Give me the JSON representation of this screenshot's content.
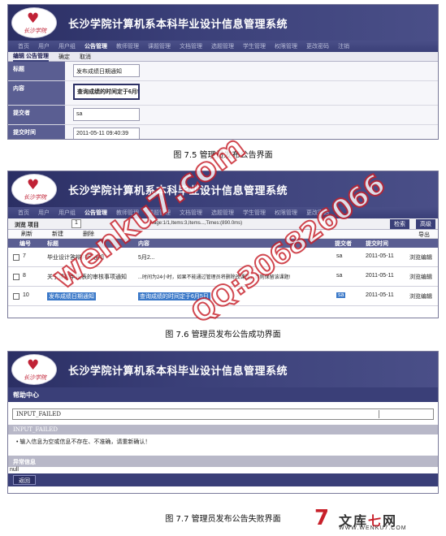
{
  "app": {
    "title": "长沙学院计算机系本科毕业设计信息管理系统",
    "logo_text": "长沙学院",
    "menu": [
      "首页",
      "用户",
      "用户组",
      "公告管理",
      "教师管理",
      "课题管理",
      "文档管理",
      "选题管理",
      "学生管理",
      "权限管理",
      "更改密码",
      "注销"
    ],
    "active_menu": "公告管理"
  },
  "shot1": {
    "subbar": {
      "edit": "编辑 公告管理",
      "confirm": "确定",
      "cancel": "取消"
    },
    "fields": [
      {
        "label": "标题",
        "value": "发布成绩日期通知"
      },
      {
        "label": "内容",
        "value": "查询成绩的时间定于6月5"
      },
      {
        "label": "提交者",
        "value": "sa"
      },
      {
        "label": "提交时间",
        "value": "2011-05-11 09:40:39"
      }
    ],
    "caption": "图 7.5 管理员发布公告界面"
  },
  "shot2": {
    "list_title": "浏览 项目",
    "page_number": "1",
    "page_info": "Page:1/1,Items:3,Items...,Times:(890.0ms)",
    "search": "检索",
    "advanced": "高级",
    "actions": {
      "refresh": "刷新",
      "new": "新建",
      "delete": "删除",
      "export": "导出"
    },
    "columns": {
      "no": "编号",
      "title": "标题",
      "content": "内容",
      "submitter": "提交者",
      "time": "提交时间"
    },
    "rows": [
      {
        "no": "7",
        "title": "毕业设计答辩时间通知",
        "content": "5月2...",
        "submitter": "sa",
        "time": "2011-05-11",
        "ops": "浏览编辑"
      },
      {
        "no": "8",
        "title": "关于课题申报表的审核事项通知",
        "content": "...时间为24小时，如果不能通过管理员将删除改课题，否则保留该课题!",
        "submitter": "sa",
        "time": "2011-05-11",
        "ops": "浏览编辑"
      },
      {
        "no": "10",
        "title": "发布成绩日期通知",
        "content": "查询成绩的时间定于6月5日",
        "submitter": "sa",
        "time": "2011-05-11",
        "ops": "浏览编辑"
      }
    ],
    "caption": "图 7.6 管理员发布公告成功界面"
  },
  "shot3": {
    "help": "帮助中心",
    "error_code": "INPUT_FAILED",
    "error_head": "INPUT_FAILED",
    "error_msg": "• 输入信息为空或信息不存在、不准确，请重新确认！",
    "exception_head": "异常信息",
    "exception_val": "null",
    "back": "返回",
    "caption": "图 7.7 管理员发布公告失败界面"
  },
  "watermark": {
    "text1": "wenku7.com",
    "text2": "QQ:306826066"
  },
  "site_logo": {
    "glyph": "7",
    "name_a": "文库",
    "name_b": "七",
    "name_c": "网",
    "url": "WWW.WENKU7.COM"
  },
  "colors": {
    "banner": "#2b2f64",
    "menu": "#3a3f78",
    "label": "#5a5e92",
    "watermark": "#c8202a"
  }
}
